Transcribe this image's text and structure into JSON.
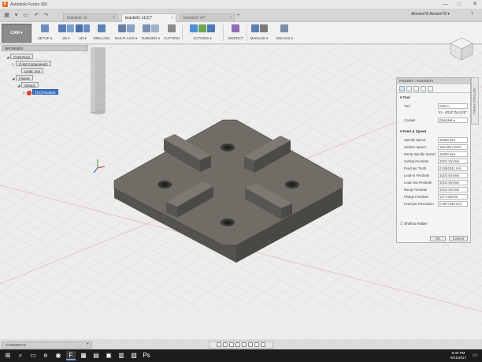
{
  "window": {
    "title": "Autodesk Fusion 360",
    "controls": [
      "—",
      "□",
      "✕"
    ]
  },
  "tabs": [
    {
      "label": "bracket1 v1",
      "active": false
    },
    {
      "label": "bracket1 v1(1)*",
      "active": true
    },
    {
      "label": "bracket2 v4*",
      "active": false
    }
  ],
  "user": {
    "name": "Akesim78 Akesim78 ▾",
    "help": "?"
  },
  "ribbon": {
    "workspace": "CAM ▾",
    "groups": [
      {
        "label": "SETUP ▾",
        "colors": [
          "#6d8fbf"
        ]
      },
      {
        "label": "2D ▾",
        "colors": [
          "#5a7fb8",
          "#7aa0d0"
        ]
      },
      {
        "label": "3D ▾",
        "colors": [
          "#4c6fa8",
          "#6b8ec6"
        ]
      },
      {
        "label": "DRILLING",
        "colors": [
          "#5d83b5"
        ]
      },
      {
        "label": "MULTI-AXIS ▾",
        "colors": [
          "#6a7fa6",
          "#8aa2c8"
        ]
      },
      {
        "label": "TURNING ▾",
        "colors": [
          "#7c8fb0",
          "#a0b2cc"
        ]
      },
      {
        "label": "CUTTING",
        "colors": [
          "#8a8a8a"
        ]
      },
      {
        "label": "ACTIONS ▾",
        "colors": [
          "#4e8fd6",
          "#6aa84f",
          "#4d79b7"
        ]
      },
      {
        "label": "INSPECT",
        "colors": [
          "#8f6fb0"
        ]
      },
      {
        "label": "MANAGE ▾",
        "colors": [
          "#5a7fb8",
          "#7b7b7b"
        ]
      },
      {
        "label": "ADD-INS ▾",
        "colors": [
          "#7b8ca8"
        ]
      }
    ]
  },
  "browser": {
    "header": "BROWSER",
    "nodes": [
      {
        "label": "CAM Root",
        "indent": 0,
        "tri": "◢",
        "selected": false,
        "error": false
      },
      {
        "label": "CAM Component1",
        "indent": 1,
        "tri": "▷",
        "selected": false,
        "error": false
      },
      {
        "label": "Units: mm",
        "indent": 2,
        "tri": "",
        "selected": false,
        "error": false
      },
      {
        "label": "Fixture",
        "indent": 1,
        "tri": "◢",
        "selected": false,
        "error": false
      },
      {
        "label": "Setup1",
        "indent": 2,
        "tri": "◢",
        "selected": false,
        "error": false
      },
      {
        "label": "[T1] Pocket1",
        "indent": 3,
        "tri": "▷",
        "selected": true,
        "error": true
      }
    ]
  },
  "panel": {
    "title": "POCKET : POCKET1",
    "sidetab": "SETTINGS PANEL",
    "sections": [
      {
        "title": "▾ Tool",
        "rows": [
          {
            "label": "Tool",
            "value": "Select...",
            "plain": false
          },
          {
            "label": "",
            "value": "#1 - Ø1/8\" flat (1/8\" F...",
            "plain": true
          },
          {
            "label": "Coolant",
            "value": "Disabled ▾",
            "plain": false
          }
        ]
      },
      {
        "title": "▾ Feed & Speed",
        "rows": [
          {
            "label": "Spindle Speed",
            "value": "16400 rpm",
            "plain": false
          },
          {
            "label": "Surface Speed",
            "value": "163.363 m/min",
            "plain": false
          },
          {
            "label": "Ramp Spindle Speed",
            "value": "16400 rpm",
            "plain": false
          },
          {
            "label": "Cutting Feedrate",
            "value": "1520 mm/min",
            "plain": false
          },
          {
            "label": "Feed per Tooth",
            "value": "0.0463341 mm",
            "plain": false
          },
          {
            "label": "Lead-In Feedrate",
            "value": "1016 mm/min",
            "plain": false
          },
          {
            "label": "Lead-Out Feedrate",
            "value": "1016 mm/min",
            "plain": false
          },
          {
            "label": "Ramp Feedrate",
            "value": "1016 mm/min",
            "plain": false
          },
          {
            "label": "Plunge Feedrate",
            "value": "127 mm/min",
            "plain": false
          },
          {
            "label": "Feed per Revolution",
            "value": "0.0977439 mm",
            "plain": false
          }
        ]
      }
    ],
    "shaft": "Shaft & Holder",
    "ok": "OK",
    "cancel": "Cancel"
  },
  "bottom": {
    "comments": "COMMENTS",
    "plus": "+"
  },
  "taskbar": {
    "icons": [
      {
        "glyph": "⊞",
        "active": false
      },
      {
        "glyph": "⌕",
        "active": false
      },
      {
        "glyph": "▭",
        "active": false
      },
      {
        "glyph": "e",
        "active": false
      },
      {
        "glyph": "◉",
        "active": false
      },
      {
        "glyph": "F",
        "active": true
      },
      {
        "glyph": "▦",
        "active": false
      },
      {
        "glyph": "▤",
        "active": false
      },
      {
        "glyph": "▣",
        "active": false
      },
      {
        "glyph": "▥",
        "active": false
      },
      {
        "glyph": "▧",
        "active": false
      },
      {
        "glyph": "Ps",
        "active": false
      }
    ],
    "time": "8:30 PM",
    "date": "8/21/2017"
  },
  "colors": {
    "accent": "#3d73c7",
    "part_top": "#6e6c65",
    "part_side": "#514f49",
    "error": "#d62d20"
  }
}
